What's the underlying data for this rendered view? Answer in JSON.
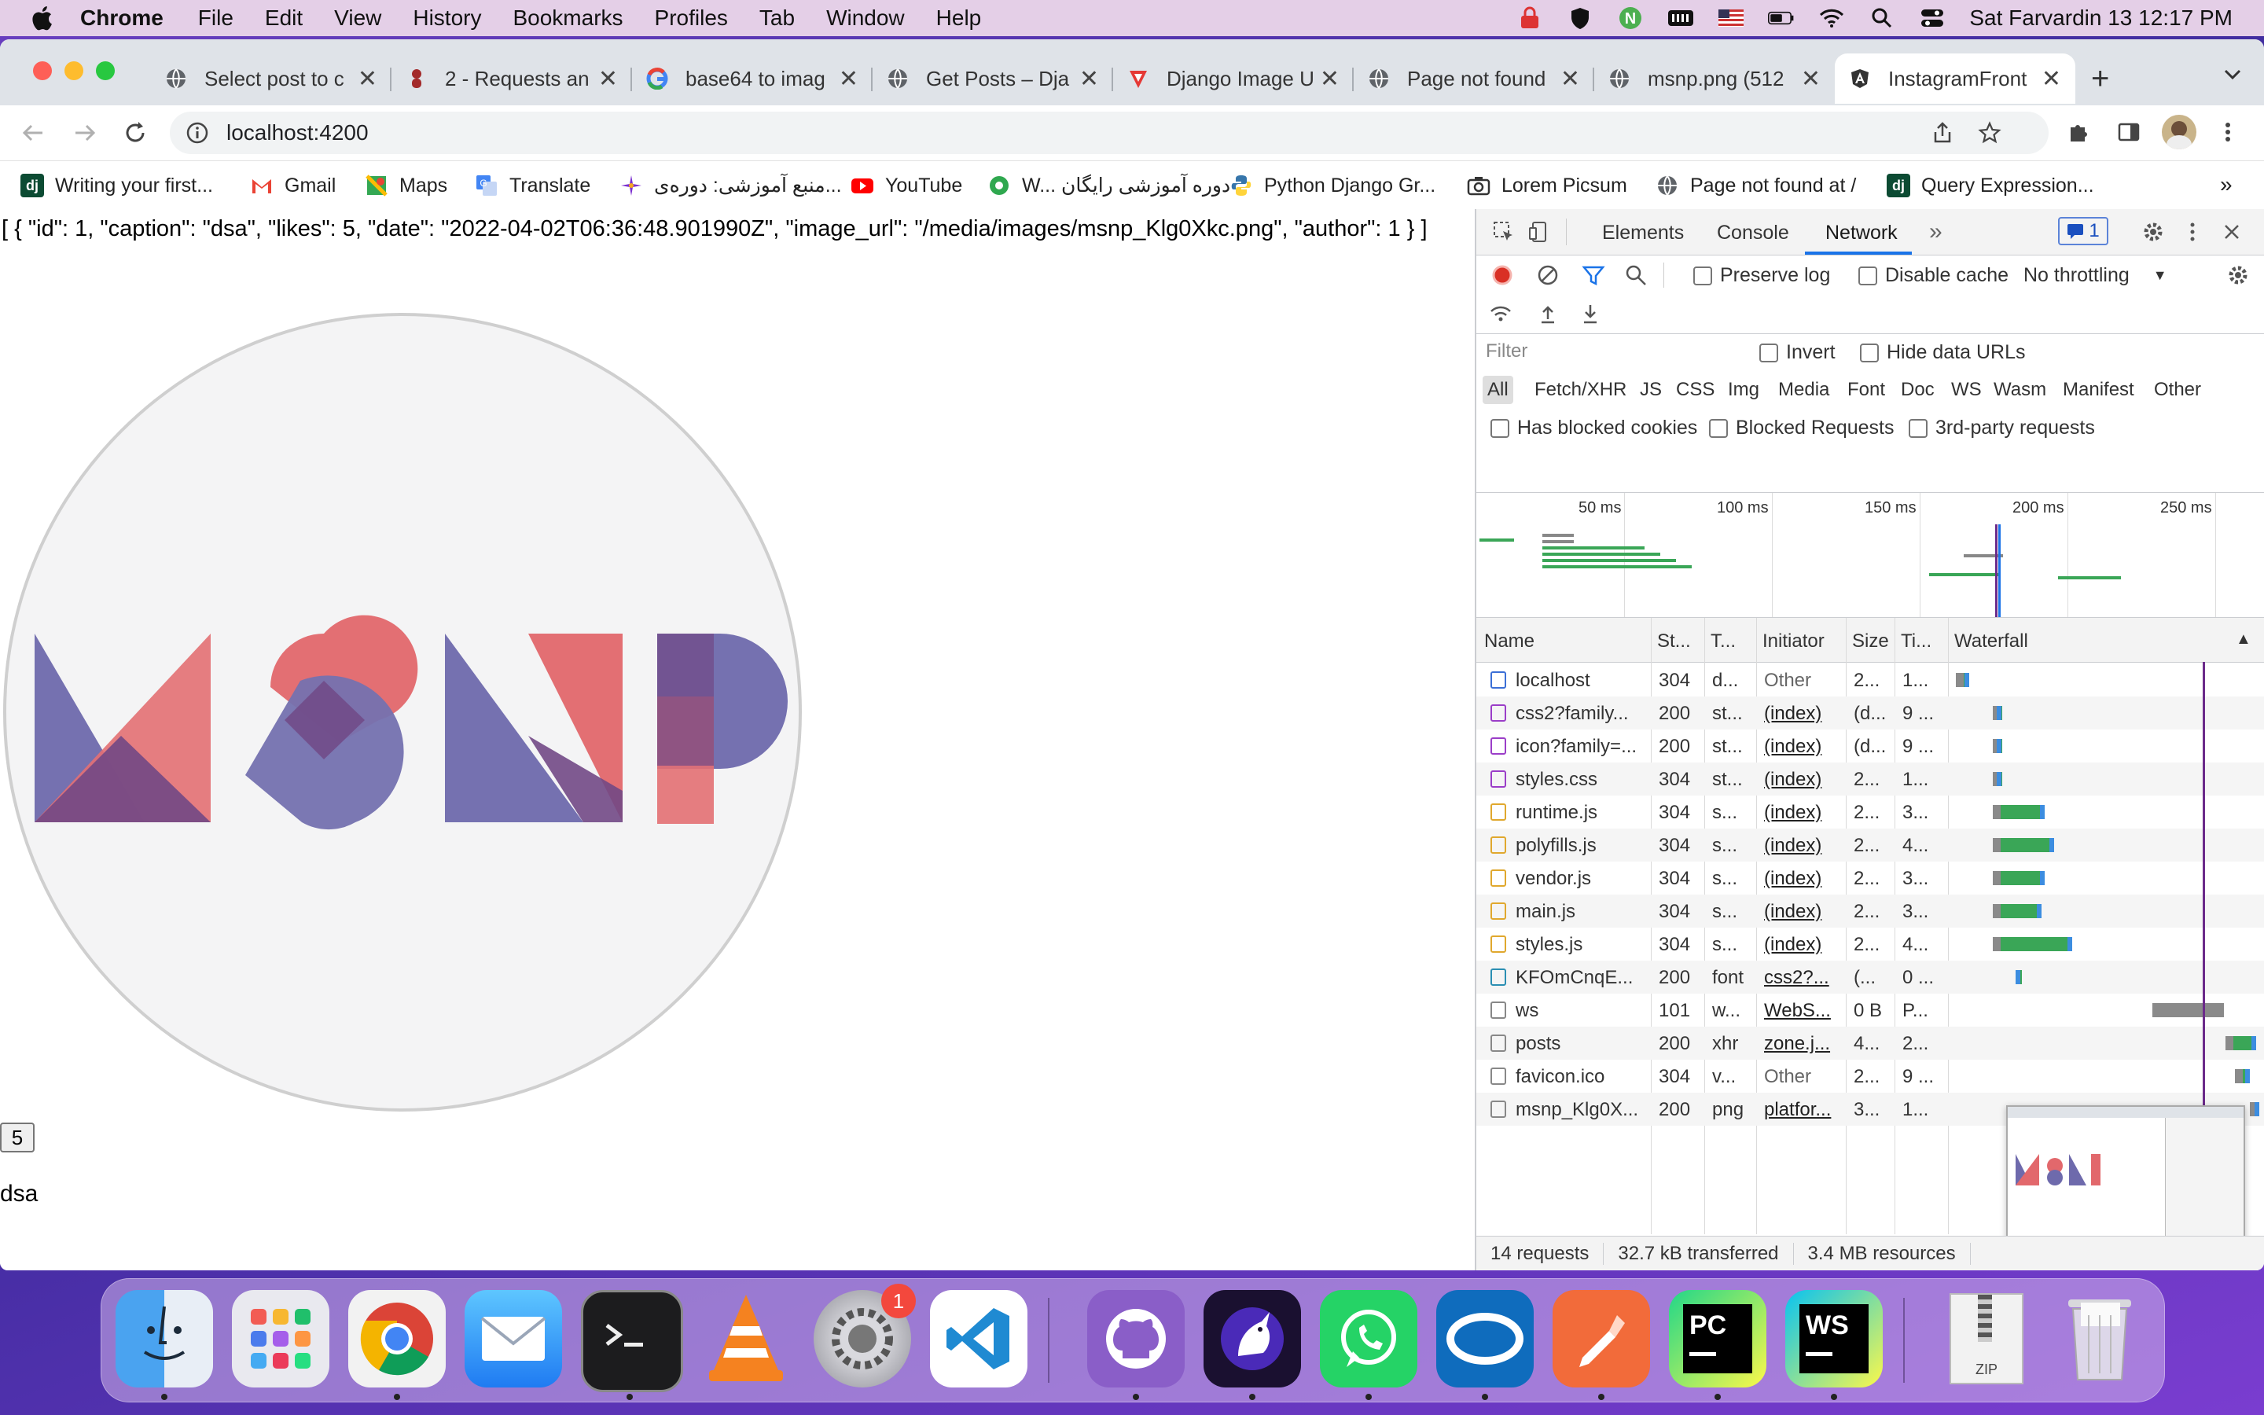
{
  "menubar": {
    "app_name": "Chrome",
    "items": [
      "File",
      "Edit",
      "View",
      "History",
      "Bookmarks",
      "Profiles",
      "Tab",
      "Window",
      "Help"
    ],
    "clock": "Sat Farvardin 13  12:17 PM",
    "profile_letter": "N"
  },
  "browser": {
    "tabs": [
      {
        "title": "Select post to c",
        "favicon": "globe-icon"
      },
      {
        "title": "2 - Requests an",
        "favicon": "app-icon"
      },
      {
        "title": "base64 to imag",
        "favicon": "google-icon"
      },
      {
        "title": "Get Posts – Dja",
        "favicon": "globe-icon"
      },
      {
        "title": "Django Image U",
        "favicon": "app-icon"
      },
      {
        "title": "Page not found",
        "favicon": "globe-icon"
      },
      {
        "title": "msnp.png (512",
        "favicon": "globe-icon"
      },
      {
        "title": "InstagramFront",
        "favicon": "angular-icon",
        "active": true
      }
    ],
    "url": "localhost:4200",
    "bookmarks": [
      "Writing your first...",
      "Gmail",
      "Maps",
      "Translate",
      "منبع آموزشی: دوره‌ی...",
      "YouTube",
      "W... دوره آموزشی رایگان",
      "Python Django Gr...",
      "Lorem Picsum",
      "Page not found at /",
      "Query Expression..."
    ],
    "bookmarks_overflow": "»"
  },
  "page": {
    "json_text": "[ { \"id\": 1, \"caption\": \"dsa\", \"likes\": 5, \"date\": \"2022-04-02T06:36:48.901990Z\", \"image_url\": \"/media/images/msnp_Klg0Xkc.png\", \"author\": 1 } ]",
    "likes_button": "5",
    "caption": "dsa",
    "image_alt": "MSNP"
  },
  "devtools": {
    "tabs": [
      "Elements",
      "Console",
      "Network"
    ],
    "active_tab": "Network",
    "more_tabs": "»",
    "issues_count": "1",
    "preserve_log": "Preserve log",
    "disable_cache": "Disable cache",
    "throttling": "No throttling",
    "filter_placeholder": "Filter",
    "invert": "Invert",
    "hide_data_urls": "Hide data URLs",
    "type_filters": [
      "All",
      "Fetch/XHR",
      "JS",
      "CSS",
      "Img",
      "Media",
      "Font",
      "Doc",
      "WS",
      "Wasm",
      "Manifest",
      "Other"
    ],
    "has_blocked_cookies": "Has blocked cookies",
    "blocked_requests": "Blocked Requests",
    "third_party": "3rd-party requests",
    "overview_ticks": [
      "50 ms",
      "100 ms",
      "150 ms",
      "200 ms",
      "250 ms"
    ],
    "columns": [
      "Name",
      "St...",
      "T...",
      "Initiator",
      "Size",
      "Ti...",
      "Waterfall"
    ],
    "requests": [
      {
        "name": "localhost",
        "status": "304",
        "type": "d...",
        "initiator": "Other",
        "size": "2...",
        "time": "1...",
        "kind": "doc",
        "wf_start": 0.01,
        "wf_len": 0.045
      },
      {
        "name": "css2?family...",
        "status": "200",
        "type": "st...",
        "initiator": "(index)",
        "size": "(d...",
        "time": "9 ...",
        "kind": "css",
        "wf_start": 0.13,
        "wf_len": 0.03
      },
      {
        "name": "icon?family=...",
        "status": "200",
        "type": "st...",
        "initiator": "(index)",
        "size": "(d...",
        "time": "9 ...",
        "kind": "css",
        "wf_start": 0.13,
        "wf_len": 0.03
      },
      {
        "name": "styles.css",
        "status": "304",
        "type": "st...",
        "initiator": "(index)",
        "size": "2...",
        "time": "1...",
        "kind": "css",
        "wf_start": 0.13,
        "wf_len": 0.03
      },
      {
        "name": "runtime.js",
        "status": "304",
        "type": "s...",
        "initiator": "(index)",
        "size": "2...",
        "time": "3...",
        "kind": "js",
        "wf_start": 0.13,
        "wf_len": 0.17
      },
      {
        "name": "polyfills.js",
        "status": "304",
        "type": "s...",
        "initiator": "(index)",
        "size": "2...",
        "time": "4...",
        "kind": "js",
        "wf_start": 0.13,
        "wf_len": 0.2
      },
      {
        "name": "vendor.js",
        "status": "304",
        "type": "s...",
        "initiator": "(index)",
        "size": "2...",
        "time": "3...",
        "kind": "js",
        "wf_start": 0.13,
        "wf_len": 0.17
      },
      {
        "name": "main.js",
        "status": "304",
        "type": "s...",
        "initiator": "(index)",
        "size": "2...",
        "time": "3...",
        "kind": "js",
        "wf_start": 0.13,
        "wf_len": 0.16
      },
      {
        "name": "styles.js",
        "status": "304",
        "type": "s...",
        "initiator": "(index)",
        "size": "2...",
        "time": "4...",
        "kind": "js",
        "wf_start": 0.13,
        "wf_len": 0.26
      },
      {
        "name": "KFOmCnqE...",
        "status": "200",
        "type": "font",
        "initiator": "css2?...",
        "size": "(...",
        "time": "0 ...",
        "kind": "font",
        "wf_start": 0.21,
        "wf_len": 0.01
      },
      {
        "name": "ws",
        "status": "101",
        "type": "w...",
        "initiator": "WebS...",
        "size": "0 B",
        "time": "P...",
        "kind": "ws",
        "wf_start": 0.65,
        "wf_len": 0.25
      },
      {
        "name": "posts",
        "status": "200",
        "type": "xhr",
        "initiator": "zone.j...",
        "size": "4...",
        "time": "2...",
        "kind": "xhr",
        "wf_start": 0.89,
        "wf_len": 0.1
      },
      {
        "name": "favicon.ico",
        "status": "304",
        "type": "v...",
        "initiator": "Other",
        "size": "2...",
        "time": "9 ...",
        "kind": "img",
        "wf_start": 0.92,
        "wf_len": 0.05
      },
      {
        "name": "msnp_Klg0X...",
        "status": "200",
        "type": "png",
        "initiator": "platfor...",
        "size": "3...",
        "time": "1...",
        "kind": "img",
        "wf_start": 0.97,
        "wf_len": 0.03
      }
    ],
    "status": {
      "requests": "14 requests",
      "transferred": "32.7 kB transferred",
      "resources": "3.4 MB resources"
    }
  },
  "dock": {
    "apps": [
      "finder-icon",
      "launchpad-icon",
      "chrome-icon",
      "mail-icon",
      "terminal-icon",
      "vlc-icon",
      "system-preferences-icon",
      "vscode-icon",
      "github-desktop-icon",
      "unicorn-browser-icon",
      "whatsapp-icon",
      "outlook-icon",
      "postman-icon",
      "pycharm-icon",
      "webstorm-icon",
      "zip-archive-icon",
      "trash-icon"
    ],
    "system_preferences_badge": "1",
    "pycharm_label": "PC",
    "webstorm_label": "WS",
    "zip_label": "ZIP"
  },
  "colors": {
    "msnp_purple": "#6e6aac",
    "msnp_red": "#e2686c",
    "chrome_blue": "#1a73e8",
    "waterfall_green": "#3aa657",
    "waterfall_blue": "#3c8de0"
  }
}
